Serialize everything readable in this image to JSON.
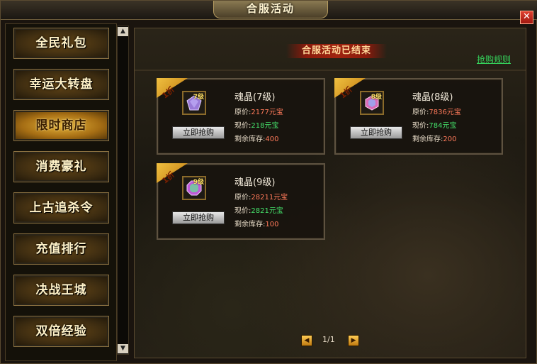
{
  "window": {
    "title": "合服活动",
    "close_label": "✕"
  },
  "sidebar": {
    "items": [
      {
        "label": "全民礼包",
        "active": false
      },
      {
        "label": "幸运大转盘",
        "active": false
      },
      {
        "label": "限时商店",
        "active": true
      },
      {
        "label": "消费豪礼",
        "active": false
      },
      {
        "label": "上古追杀令",
        "active": false
      },
      {
        "label": "充值排行",
        "active": false
      },
      {
        "label": "决战王城",
        "active": false
      },
      {
        "label": "双倍经验",
        "active": false
      }
    ]
  },
  "scrollbar": {
    "up_icon": "▲",
    "down_icon": "▼"
  },
  "main": {
    "banner": "合服活动已结束",
    "rules_link": "抢购规则",
    "products": [
      {
        "discount": "1折",
        "name": "魂晶(7级)",
        "level_tag": "7级",
        "orig_label": "原价:",
        "orig_price": "2177元宝",
        "now_label": "现价:",
        "now_price": "218元宝",
        "stock_label": "剩余库存:",
        "stock": "400",
        "buy_label": "立即抢购",
        "gem_color": "#9a7ad8"
      },
      {
        "discount": "1折",
        "name": "魂晶(8级)",
        "level_tag": "8级",
        "orig_label": "原价:",
        "orig_price": "7836元宝",
        "now_label": "现价:",
        "now_price": "784元宝",
        "stock_label": "剩余库存:",
        "stock": "200",
        "buy_label": "立即抢购",
        "gem_color": "#d86ab8"
      },
      {
        "discount": "1折",
        "name": "魂晶(9级)",
        "level_tag": "9级",
        "orig_label": "原价:",
        "orig_price": "28211元宝",
        "now_label": "现价:",
        "now_price": "2821元宝",
        "stock_label": "剩余库存:",
        "stock": "100",
        "buy_label": "立即抢购",
        "gem_color": "#6ad89a"
      }
    ],
    "pager": {
      "prev_icon": "◀",
      "text": "1/1",
      "next_icon": "▶"
    }
  }
}
